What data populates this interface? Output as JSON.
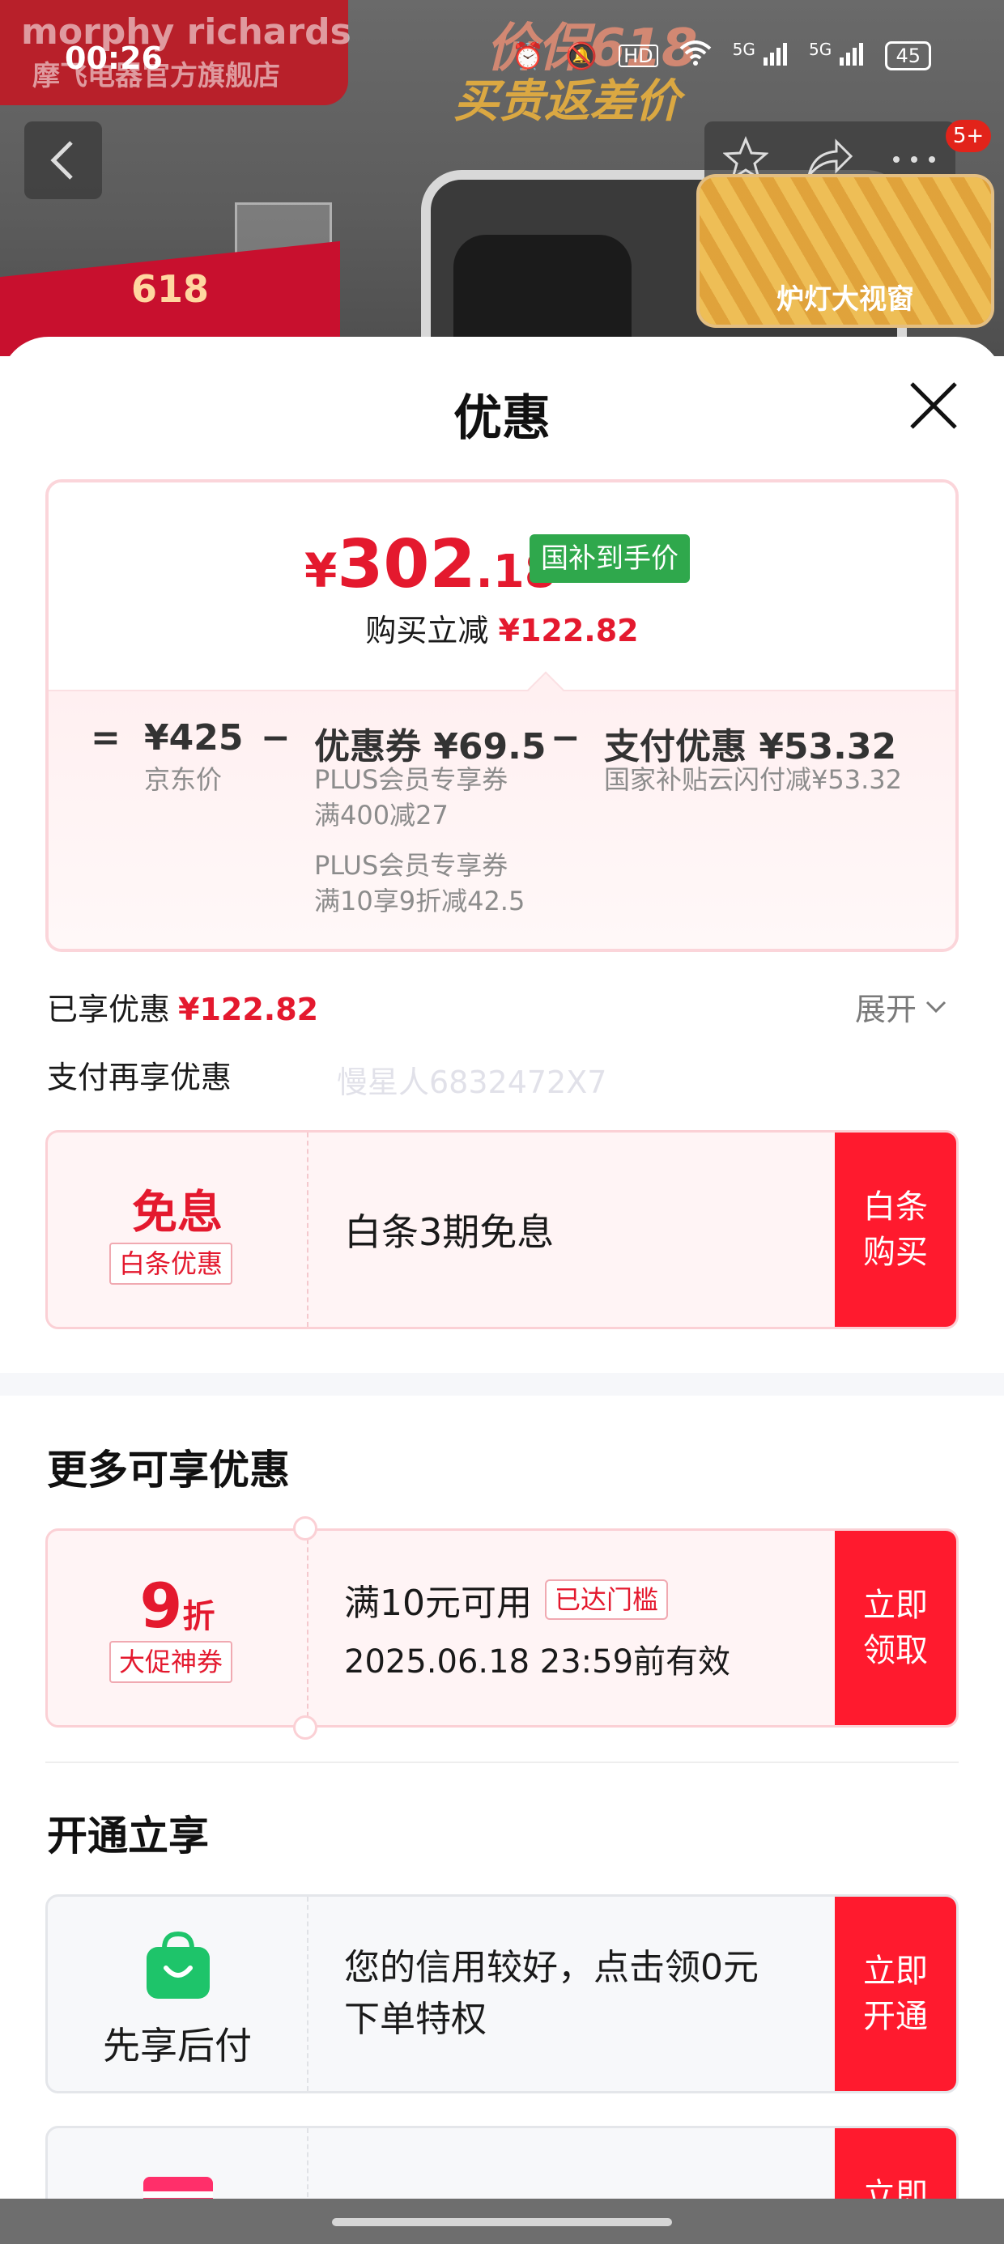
{
  "status_bar": {
    "time": "00:26",
    "icons": [
      "alarm-icon",
      "mute-icon",
      "hd-icon",
      "wifi-icon",
      "signal-5g-icon",
      "signal-5g-icon"
    ],
    "hd_label": "HD",
    "signal_label": "5G",
    "battery": "45"
  },
  "store_header": {
    "brand": "morphy richards",
    "store_name": "摩飞电器官方旗舰店",
    "promo_line1": "价保618",
    "promo_line2": "买贵返差价",
    "badge": "618",
    "thumb_label": "炉灯大视窗",
    "message_badge": "5+"
  },
  "sheet": {
    "title": "优惠"
  },
  "price_summary": {
    "currency": "¥",
    "price_int": "302",
    "price_dec": ".18",
    "price_tag": "国补到手价",
    "reduce_label": "购买立减",
    "reduce_value": "¥122.82",
    "calc": {
      "equals": "=",
      "minus": "−",
      "base_value": "¥425",
      "base_label": "京东价",
      "coupon_value": "优惠券 ¥69.5",
      "coupon_line1": "PLUS会员专享券",
      "coupon_line2": "满400减27",
      "coupon_line3": "PLUS会员专享券",
      "coupon_line4": "满10享9折减42.5",
      "pay_value": "支付优惠 ¥53.32",
      "pay_label": "国家补贴云闪付减¥53.32"
    }
  },
  "enjoyed": {
    "label": "已享优惠",
    "value": "¥122.82",
    "expand_label": "展开"
  },
  "pay_more": {
    "label": "支付再享优惠",
    "watermark": "慢星人6832472X7"
  },
  "baitiao_offer": {
    "big": "免息",
    "tag": "白条优惠",
    "text": "白条3期免息",
    "action_line1": "白条",
    "action_line2": "购买"
  },
  "more_offers": {
    "title": "更多可享优惠",
    "coupon": {
      "num": "9",
      "unit": "折",
      "tag": "大促神券",
      "condition": "满10元可用",
      "status_tag": "已达门槛",
      "valid": "2025.06.18 23:59前有效",
      "action_line1": "立即",
      "action_line2": "领取"
    }
  },
  "open_enjoy": {
    "title": "开通立享",
    "paylater": {
      "label": "先享后付",
      "text_line1": "您的信用较好，点击领0元",
      "text_line2": "下单特权",
      "action_line1": "立即",
      "action_line2": "开通"
    },
    "partial_action": "立即"
  },
  "colors": {
    "accent_red": "#e4192e",
    "button_red": "#ff1a2e",
    "gov_green": "#2fa84c",
    "pay_green": "#1ec46a"
  }
}
